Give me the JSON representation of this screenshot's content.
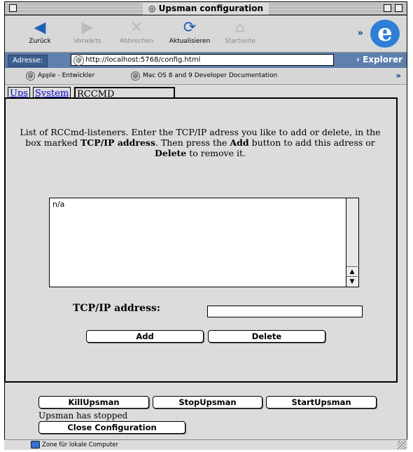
{
  "window": {
    "title": "Upsman configuration"
  },
  "toolbar": {
    "back": "Zurück",
    "forward": "Vorwärts",
    "stop": "Abbrechen",
    "refresh": "Aktualisieren",
    "home": "Startseite"
  },
  "address": {
    "label": "Adresse:",
    "url": "http://localhost:5768/config.html",
    "explorer": "Explorer"
  },
  "favorites": [
    {
      "label": "Apple - Entwickler"
    },
    {
      "label": "Mac OS 8 and 9 Developer Documentation"
    }
  ],
  "tabs": {
    "ups": "Ups",
    "system": "System",
    "rccmd": "RCCMD"
  },
  "main": {
    "intro_part1": "List of RCCmd-listeners. Enter the TCP/IP adress you like to add or delete, in the box marked ",
    "intro_bold1": "TCP/IP address",
    "intro_part2": ". Then press the ",
    "intro_bold2": "Add",
    "intro_part3": " button to add this adress or ",
    "intro_bold3": "Delete",
    "intro_part4": " to remove it.",
    "list_items": [
      "n/a"
    ],
    "ip_label": "TCP/IP address:",
    "ip_value": "",
    "add_label": "Add",
    "delete_label": "Delete"
  },
  "controls": {
    "kill_label": "KillUpsman",
    "stop_label": "StopUpsman",
    "start_label": "StartUpsman",
    "status": "Upsman has stopped",
    "close_label": "Close Configuration"
  },
  "statusbar": {
    "zone": "Zone für lokale Computer"
  }
}
